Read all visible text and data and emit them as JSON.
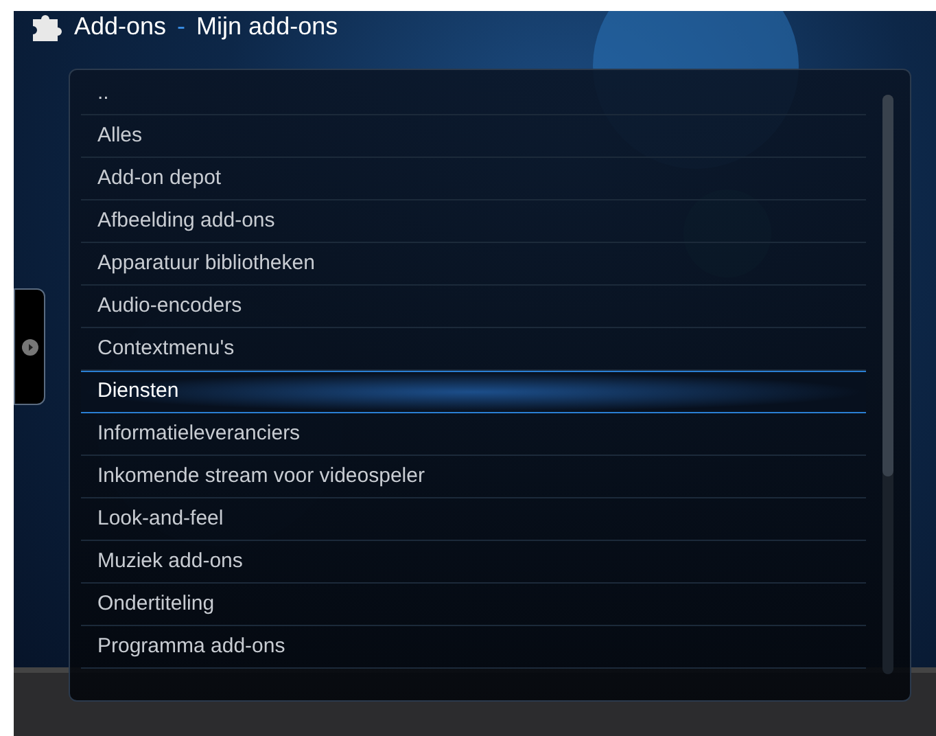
{
  "header": {
    "title": "Add-ons",
    "separator": "-",
    "subtitle": "Mijn add-ons"
  },
  "list": {
    "items": [
      {
        "label": "..",
        "selected": false
      },
      {
        "label": "Alles",
        "selected": false
      },
      {
        "label": "Add-on depot",
        "selected": false
      },
      {
        "label": "Afbeelding add-ons",
        "selected": false
      },
      {
        "label": "Apparatuur bibliotheken",
        "selected": false
      },
      {
        "label": "Audio-encoders",
        "selected": false
      },
      {
        "label": "Contextmenu's",
        "selected": false
      },
      {
        "label": "Diensten",
        "selected": true
      },
      {
        "label": "Informatieleveranciers",
        "selected": false
      },
      {
        "label": "Inkomende stream voor videospeler",
        "selected": false
      },
      {
        "label": "Look-and-feel",
        "selected": false
      },
      {
        "label": "Muziek add-ons",
        "selected": false
      },
      {
        "label": "Ondertiteling",
        "selected": false
      },
      {
        "label": "Programma add-ons",
        "selected": false
      }
    ]
  }
}
